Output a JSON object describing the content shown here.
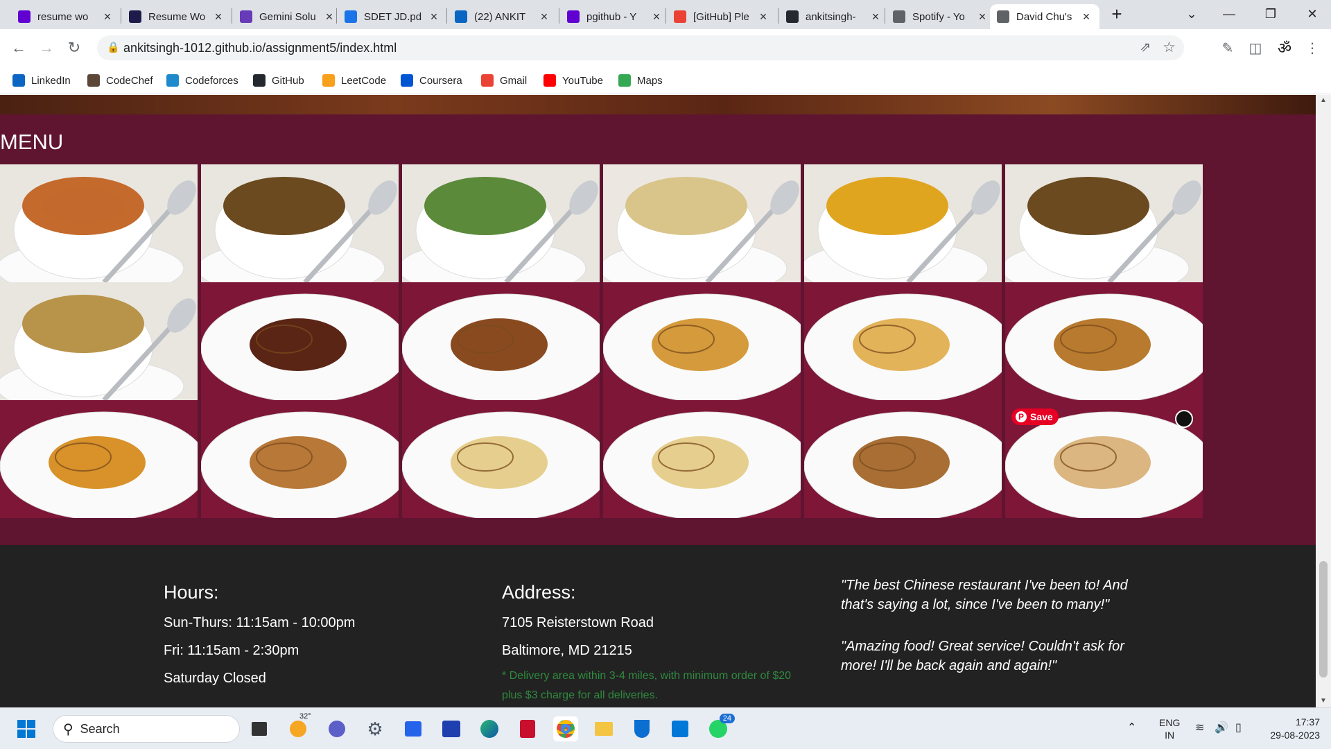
{
  "tabs": [
    {
      "title": "resume wo",
      "favicon": "yahoo-icon",
      "color": "#6001d2"
    },
    {
      "title": "Resume Wo",
      "favicon": "r-icon",
      "color": "#1e1b4b"
    },
    {
      "title": "Gemini Solu",
      "favicon": "forms-icon",
      "color": "#673ab7"
    },
    {
      "title": "SDET JD.pd",
      "favicon": "drive-icon",
      "color": "#1a73e8"
    },
    {
      "title": "(22) ANKIT",
      "favicon": "linkedin-icon",
      "color": "#0a66c2"
    },
    {
      "title": "pgithub - Y",
      "favicon": "yahoo-icon",
      "color": "#6001d2"
    },
    {
      "title": "[GitHub] Ple",
      "favicon": "gmail-icon",
      "color": "#ea4335"
    },
    {
      "title": "ankitsingh-",
      "favicon": "github-icon",
      "color": "#24292f"
    },
    {
      "title": "Spotify - Yo",
      "favicon": "globe-icon",
      "color": "#5f6368"
    },
    {
      "title": "David Chu's",
      "favicon": "globe-icon",
      "color": "#5f6368",
      "active": true
    }
  ],
  "toolbar": {
    "url": "ankitsingh-1012.github.io/assignment5/index.html"
  },
  "bookmarks": [
    {
      "label": "LinkedIn",
      "icon": "linkedin-icon",
      "color": "#0a66c2"
    },
    {
      "label": "CodeChef",
      "icon": "codechef-icon",
      "color": "#5b4638"
    },
    {
      "label": "Codeforces",
      "icon": "codeforces-icon",
      "color": "#1f8acb"
    },
    {
      "label": "GitHub",
      "icon": "github-icon",
      "color": "#24292f"
    },
    {
      "label": "LeetCode",
      "icon": "leetcode-icon",
      "color": "#f89f1b"
    },
    {
      "label": "Coursera",
      "icon": "coursera-icon",
      "color": "#0056d2"
    },
    {
      "label": "Gmail",
      "icon": "gmail-icon",
      "color": "#ea4335"
    },
    {
      "label": "YouTube",
      "icon": "youtube-icon",
      "color": "#ff0000"
    },
    {
      "label": "Maps",
      "icon": "maps-icon",
      "color": "#34a853"
    }
  ],
  "page": {
    "menu_title": "MENU",
    "tiles": [
      {
        "dish": "soup-broccoli-carrot",
        "bg": "#e9e6e0",
        "food": "#c46a2d"
      },
      {
        "dish": "wonton-broth",
        "bg": "#e9e6e0",
        "food": "#6b4a1f"
      },
      {
        "dish": "soup-greens",
        "bg": "#e9e6e0",
        "food": "#5a8a3a"
      },
      {
        "dish": "wonton-soup",
        "bg": "#ece8e1",
        "food": "#d9c58a"
      },
      {
        "dish": "egg-drop-soup",
        "bg": "#e9e6e0",
        "food": "#e0a51f"
      },
      {
        "dish": "noodle-soup",
        "bg": "#e9e6e0",
        "food": "#6b4a1f"
      },
      {
        "dish": "tofu-veg-soup",
        "bg": "#e9e6e0",
        "food": "#b8934a"
      },
      {
        "dish": "spare-ribs",
        "bg": "#7d1637",
        "food": "#5a2515"
      },
      {
        "dish": "pu-pu-platter",
        "bg": "#7d1637",
        "food": "#8a4a20"
      },
      {
        "dish": "egg-roll",
        "bg": "#7d1637",
        "food": "#d59a3c"
      },
      {
        "dish": "spring-roll",
        "bg": "#7d1637",
        "food": "#e3b35a"
      },
      {
        "dish": "egg-roll-2",
        "bg": "#7d1637",
        "food": "#b87a2e"
      },
      {
        "dish": "fried-wontons",
        "bg": "#7d1637",
        "food": "#d9922a"
      },
      {
        "dish": "shrimp-toast",
        "bg": "#7d1637",
        "food": "#b87838"
      },
      {
        "dish": "fried-tofu",
        "bg": "#7d1637",
        "food": "#e6cf8e"
      },
      {
        "dish": "fried-tofu-2",
        "bg": "#7d1637",
        "food": "#e6cf8e"
      },
      {
        "dish": "scallion-pancake",
        "bg": "#7d1637",
        "food": "#a86e34"
      },
      {
        "dish": "dumplings",
        "bg": "#7d1637",
        "food": "#dcb680"
      }
    ],
    "pin_save": "Save",
    "hours": {
      "heading": "Hours:",
      "lines": [
        "Sun-Thurs: 11:15am - 10:00pm",
        "Fri: 11:15am - 2:30pm",
        "Saturday Closed"
      ]
    },
    "address": {
      "heading": "Address:",
      "lines": [
        "7105 Reisterstown Road",
        "Baltimore, MD 21215"
      ],
      "note": "* Delivery area within 3-4 miles, with minimum order of $20 plus $3 charge for all deliveries."
    },
    "testimonials": [
      "\"The best Chinese restaurant I've been to! And that's saying a lot, since I've been to many!\"",
      "\"Amazing food! Great service! Couldn't ask for more! I'll be back again and again!\""
    ]
  },
  "taskbar": {
    "search_label": "Search",
    "weather_temp": "32°",
    "whatsapp_badge": "24",
    "lang_line1": "ENG",
    "lang_line2": "IN",
    "time": "17:37",
    "date": "29-08-2023"
  }
}
